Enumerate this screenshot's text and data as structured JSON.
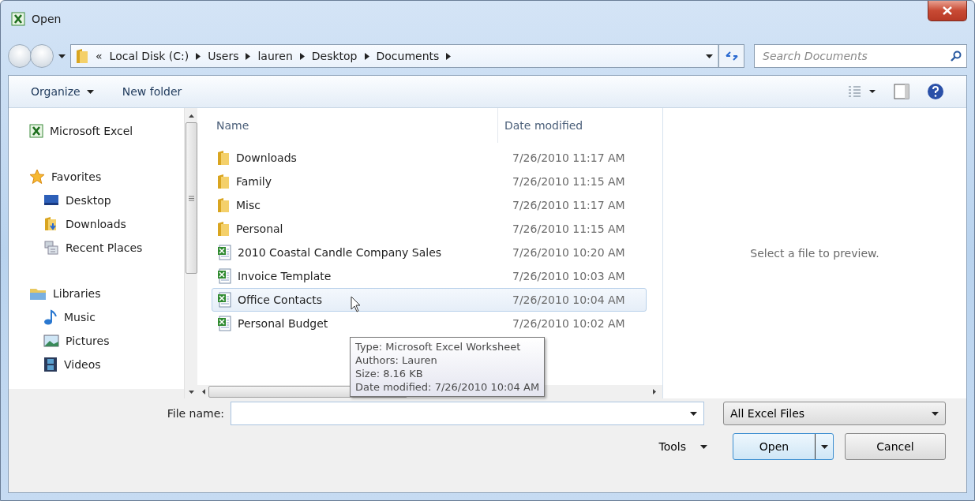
{
  "window": {
    "title": "Open"
  },
  "address": {
    "overflow": "«",
    "segments": [
      "Local Disk (C:)",
      "Users",
      "lauren",
      "Desktop",
      "Documents"
    ]
  },
  "search": {
    "placeholder": "Search Documents"
  },
  "toolbar": {
    "organize": "Organize",
    "new_folder": "New folder"
  },
  "nav": [
    {
      "label": "Microsoft Excel",
      "kind": "excel"
    },
    {
      "label": "Favorites",
      "kind": "favorites",
      "children": [
        {
          "label": "Desktop",
          "kind": "desktop"
        },
        {
          "label": "Downloads",
          "kind": "downloads"
        },
        {
          "label": "Recent Places",
          "kind": "recent"
        }
      ]
    },
    {
      "label": "Libraries",
      "kind": "libraries",
      "children": [
        {
          "label": "Music",
          "kind": "music"
        },
        {
          "label": "Pictures",
          "kind": "pictures"
        },
        {
          "label": "Videos",
          "kind": "videos"
        }
      ]
    }
  ],
  "files": {
    "columns": [
      "Name",
      "Date modified"
    ],
    "rows": [
      {
        "name": "Downloads",
        "date": "7/26/2010 11:17 AM",
        "kind": "folder",
        "hovered": false
      },
      {
        "name": "Family",
        "date": "7/26/2010 11:15 AM",
        "kind": "folder",
        "hovered": false
      },
      {
        "name": "Misc",
        "date": "7/26/2010 11:17 AM",
        "kind": "folder",
        "hovered": false
      },
      {
        "name": "Personal",
        "date": "7/26/2010 11:15 AM",
        "kind": "folder",
        "hovered": false
      },
      {
        "name": "2010 Coastal Candle Company Sales",
        "date": "7/26/2010 10:20 AM",
        "kind": "excel",
        "hovered": false
      },
      {
        "name": "Invoice Template",
        "date": "7/26/2010 10:03 AM",
        "kind": "excel",
        "hovered": false
      },
      {
        "name": "Office Contacts",
        "date": "7/26/2010 10:04 AM",
        "kind": "excel",
        "hovered": true
      },
      {
        "name": "Personal Budget",
        "date": "7/26/2010 10:02 AM",
        "kind": "excel",
        "hovered": false
      }
    ]
  },
  "tooltip": {
    "lines": [
      "Type: Microsoft Excel Worksheet",
      "Authors: Lauren",
      "Size: 8.16 KB",
      "Date modified: 7/26/2010 10:04 AM"
    ]
  },
  "preview": {
    "message": "Select a file to preview."
  },
  "file_name": {
    "label": "File name:"
  },
  "file_type": {
    "value": "All Excel Files"
  },
  "tools": "Tools",
  "buttons": {
    "open": "Open",
    "cancel": "Cancel"
  }
}
